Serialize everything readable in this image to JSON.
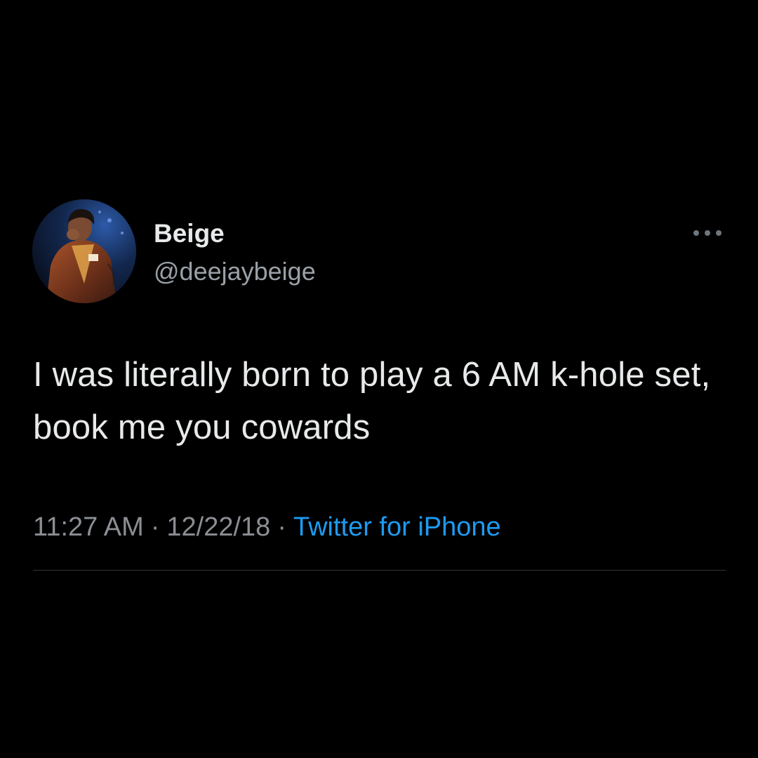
{
  "user": {
    "display_name": "Beige",
    "handle": "@deejaybeige",
    "avatar_icon": "profile-photo"
  },
  "tweet": {
    "text": "I was literally born to play a 6 AM k-hole set, book me you cowards",
    "time": "11:27 AM",
    "date": "12/22/18",
    "separator": "·",
    "source": "Twitter for iPhone"
  },
  "actions": {
    "more_icon": "more-horizontal-icon"
  },
  "colors": {
    "background": "#000000",
    "text_primary": "#e7e9ea",
    "text_secondary": "#8b8f94",
    "link": "#1d9bf0",
    "divider": "#2f3336"
  }
}
